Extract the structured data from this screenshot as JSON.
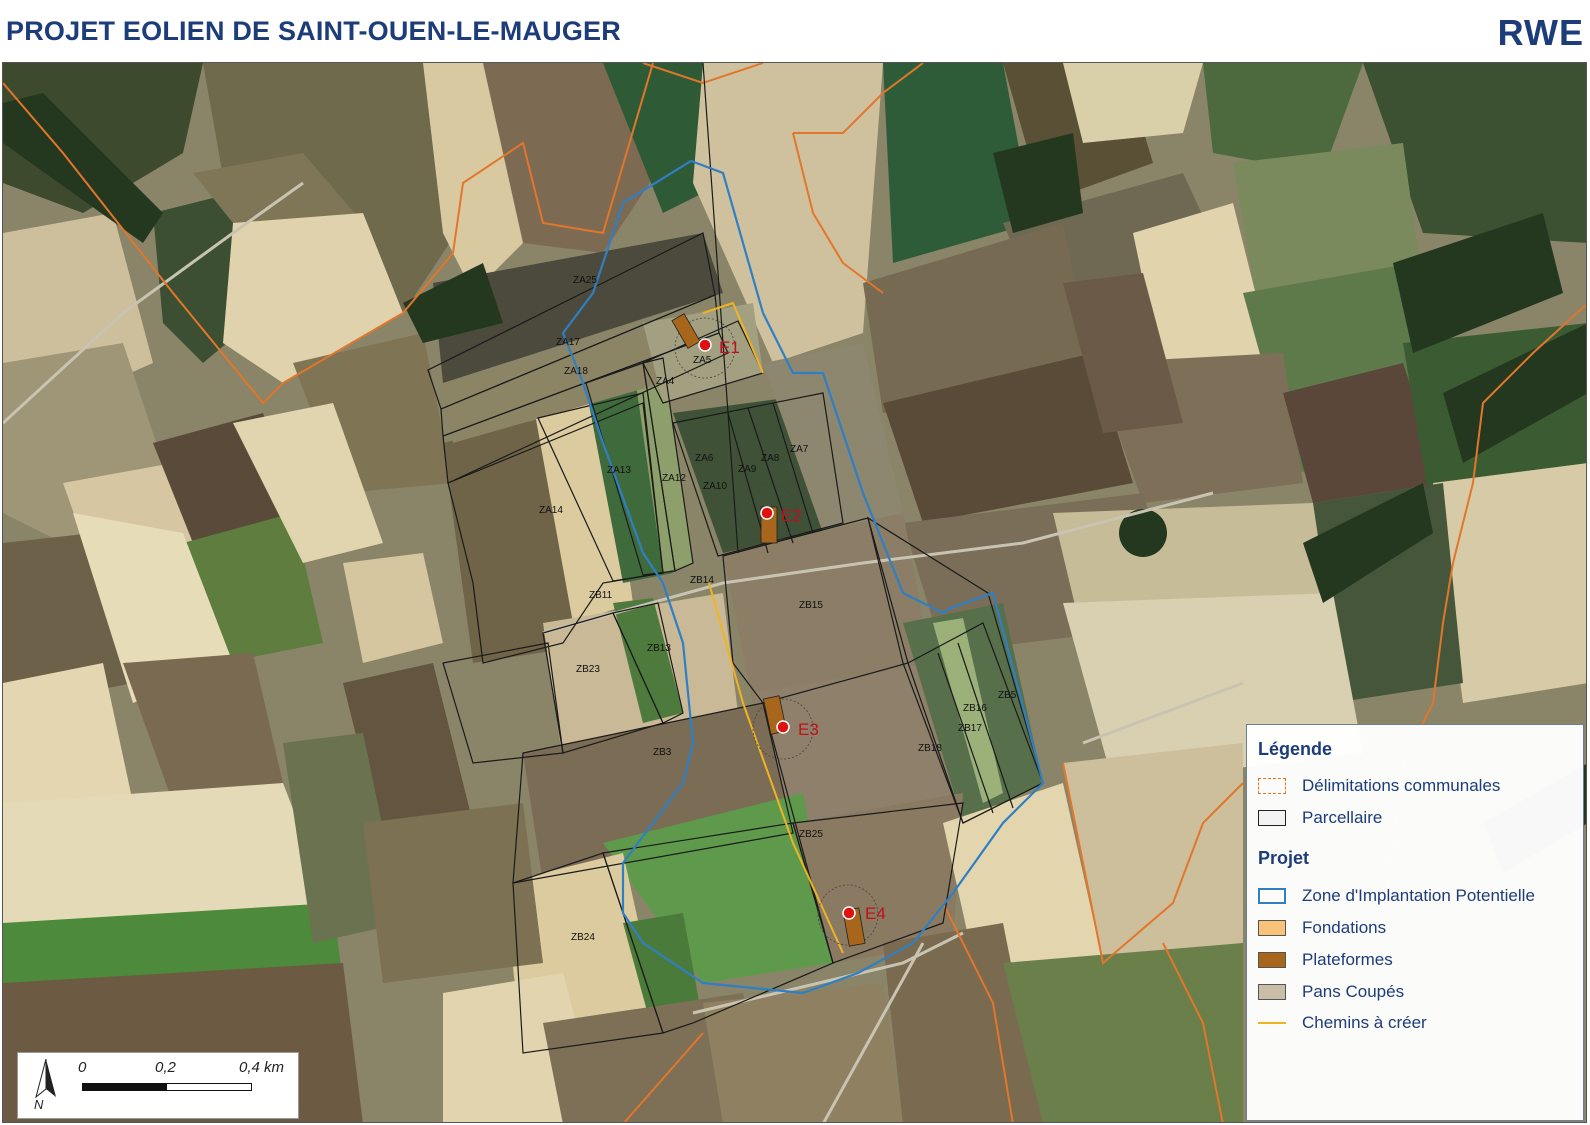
{
  "header": {
    "title": "PROJET EOLIEN DE SAINT-OUEN-LE-MAUGER",
    "logo_text": "RWE"
  },
  "colors": {
    "title": "#1d3c7a",
    "zone_outline": "#2f7fc4",
    "communal_limit": "#e2762a",
    "parcel_outline": "#222222",
    "foundation": "#f7c27a",
    "platform": "#a8661d",
    "pans_coupes": "#c9bfa8",
    "paths": "#f0b423",
    "turbine_dot": "#e01010"
  },
  "legend": {
    "title": "Légende",
    "items": [
      {
        "label": "Délimitations communales",
        "swatch": "communal-limit"
      },
      {
        "label": "Parcellaire",
        "swatch": "parcel"
      }
    ],
    "project_title": "Projet",
    "project_items": [
      {
        "label": "Zone d'Implantation Potentielle",
        "swatch": "zone"
      },
      {
        "label": "Fondations",
        "swatch": "foundation"
      },
      {
        "label": "Plateformes",
        "swatch": "platform"
      },
      {
        "label": "Pans Coupés",
        "swatch": "pans-coupes"
      },
      {
        "label": "Chemins à créer",
        "swatch": "path"
      }
    ]
  },
  "scale": {
    "ticks": [
      "0",
      "0,2",
      "0,4 km"
    ],
    "north": "N"
  },
  "turbines": [
    {
      "id": "E1",
      "label": "E1"
    },
    {
      "id": "E2",
      "label": "E2"
    },
    {
      "id": "E3",
      "label": "E3"
    },
    {
      "id": "E4",
      "label": "E4"
    }
  ],
  "parcels": {
    "ZA25": "ZA25",
    "ZA17": "ZA17",
    "ZA18": "ZA18",
    "ZA5": "ZA5",
    "ZA4": "ZA4",
    "ZA13": "ZA13",
    "ZA12": "ZA12",
    "ZA6": "ZA6",
    "ZA9": "ZA9",
    "ZA8": "ZA8",
    "ZA7": "ZA7",
    "ZA10": "ZA10",
    "ZA14": "ZA14",
    "ZB14": "ZB14",
    "ZB11": "ZB11",
    "ZB15": "ZB15",
    "ZB13": "ZB13",
    "ZB23": "ZB23",
    "ZB3": "ZB3",
    "ZB16": "ZB16",
    "ZB5": "ZB5",
    "ZB17": "ZB17",
    "ZB18": "ZB18",
    "ZB25": "ZB25",
    "ZB24": "ZB24"
  }
}
